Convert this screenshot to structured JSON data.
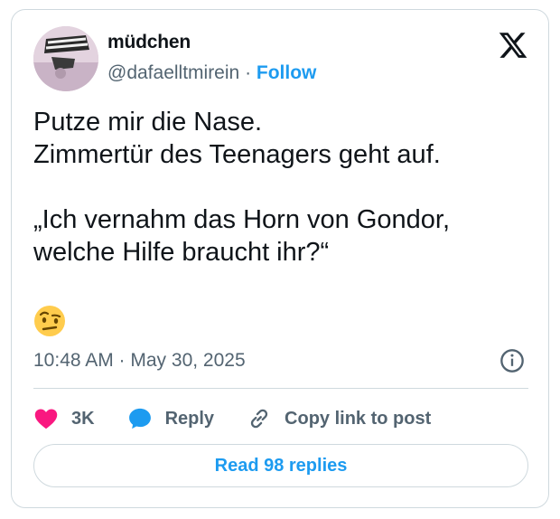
{
  "tweet": {
    "author": {
      "display_name": "müdchen",
      "handle": "@dafaelltmirein",
      "separator": "·",
      "follow_label": "Follow"
    },
    "text_lines": [
      "Putze mir die Nase.",
      "Zimmertür des Teenagers geht auf.",
      "„Ich vernahm das Horn von Gondor,",
      "welche Hilfe braucht ihr?“"
    ],
    "emoji": "face-with-raised-eyebrow",
    "timestamp": "10:48 AM · May 30, 2025",
    "actions": {
      "like_count": "3K",
      "reply_label": "Reply",
      "copy_link_label": "Copy link to post"
    },
    "read_replies_label": "Read 98 replies"
  },
  "icons": {
    "platform_logo": "x-logo-icon",
    "info": "info-icon",
    "like": "heart-icon",
    "reply": "speech-bubble-icon",
    "copy_link": "link-icon"
  },
  "colors": {
    "accent": "#1d9bf0",
    "like": "#f91880",
    "text_primary": "#0f1419",
    "text_secondary": "#536471",
    "border": "#cfd9de"
  }
}
